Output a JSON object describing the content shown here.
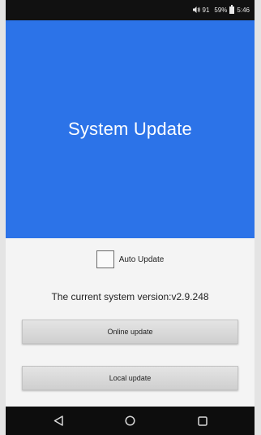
{
  "status_bar": {
    "signal_text": "91",
    "battery_text": "59%",
    "time": "5:46"
  },
  "header": {
    "title": "System Update",
    "background_color": "#2c73e8"
  },
  "auto_update": {
    "label": "Auto Update",
    "checked": false
  },
  "version_text": "The current system version:v2.9.248",
  "buttons": {
    "online": "Online update",
    "local": "Local update"
  },
  "nav_bar": {
    "back_icon": "back-triangle-icon",
    "home_icon": "home-circle-icon",
    "recents_icon": "recents-square-icon"
  }
}
